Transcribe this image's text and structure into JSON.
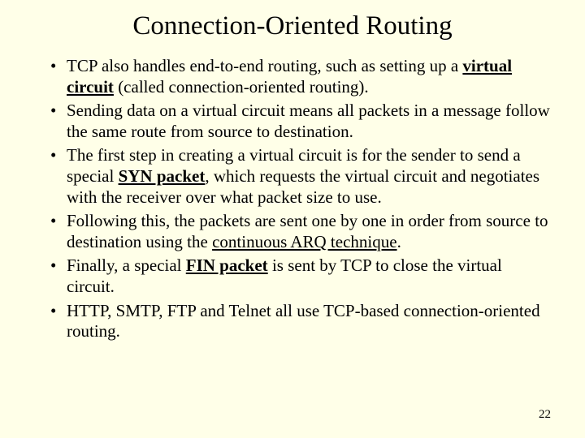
{
  "title": "Connection-Oriented Routing",
  "bullets": {
    "b1": {
      "p1": "TCP also handles end-to-end routing, such as setting up a ",
      "u1": "virtual circuit",
      "p2": " (called connection-oriented routing)."
    },
    "b2": "Sending data on a virtual circuit means all packets in a message follow the same route from source to destination.",
    "b3": {
      "p1": "The first step in creating a virtual circuit is for the sender to send a special ",
      "u1": "SYN packet",
      "p2": ", which requests the virtual circuit and negotiates with the receiver over what packet size to use."
    },
    "b4": {
      "p1": "Following this, the packets are sent one by one in order from source to destination using the ",
      "u1": "continuous ARQ technique",
      "p2": "."
    },
    "b5": {
      "p1": "Finally, a special ",
      "u1": "FIN packet",
      "p2": " is sent  by TCP to close the virtual circuit."
    },
    "b6": "HTTP, SMTP, FTP and Telnet all use TCP-based connection-oriented routing."
  },
  "page_number": "22"
}
